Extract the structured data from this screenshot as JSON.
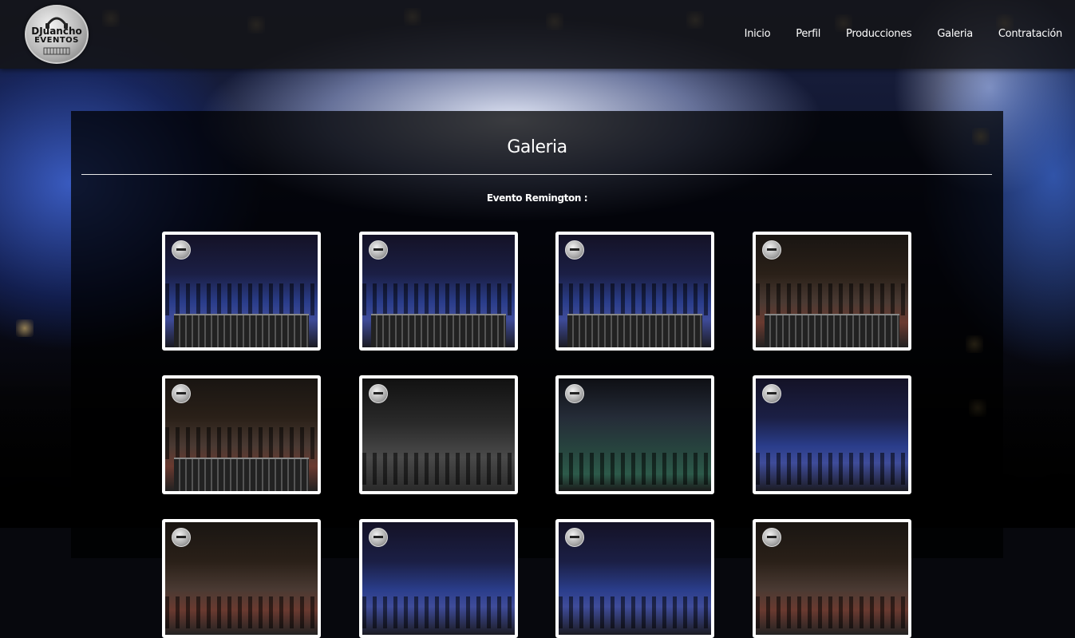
{
  "brand": {
    "logo_line1": "DJuancho",
    "logo_line2": "EVENTOS"
  },
  "nav": {
    "items": [
      {
        "label": "Inicio"
      },
      {
        "label": "Perfil"
      },
      {
        "label": "Producciones"
      },
      {
        "label": "Galeria"
      },
      {
        "label": "Contratación"
      }
    ]
  },
  "gallery": {
    "title": "Galeria",
    "event_title": "Evento Remington :",
    "thumbnails": [
      {
        "description": "night dance floor with mixer",
        "tone": "blue-night",
        "has_console": true
      },
      {
        "description": "outdoor dance floor with DJ controller",
        "tone": "blue-night",
        "has_console": true
      },
      {
        "description": "DJ controller close-up with dancers",
        "tone": "blue-night",
        "has_console": true
      },
      {
        "description": "DJ setup with tents and dancers",
        "tone": "warm-night",
        "has_console": true
      },
      {
        "description": "digital mixing console",
        "tone": "warm-night",
        "has_console": true
      },
      {
        "description": "black and white dancing couples",
        "tone": "grayscale",
        "has_console": false
      },
      {
        "description": "couples dancing on lit floor",
        "tone": "green-night",
        "has_console": false
      },
      {
        "description": "couples dancing under lights",
        "tone": "blue-night",
        "has_console": false
      },
      {
        "description": "partial thumbnail row",
        "tone": "warm-night",
        "has_console": false
      },
      {
        "description": "partial thumbnail row",
        "tone": "blue-night",
        "has_console": false
      },
      {
        "description": "partial thumbnail row",
        "tone": "blue-night",
        "has_console": false
      },
      {
        "description": "partial thumbnail row",
        "tone": "warm-night",
        "has_console": false
      }
    ]
  },
  "colors": {
    "header_bg": "#141416",
    "panel_bg": "#000000",
    "text": "#ffffff",
    "thumb_border": "#ffffff"
  }
}
